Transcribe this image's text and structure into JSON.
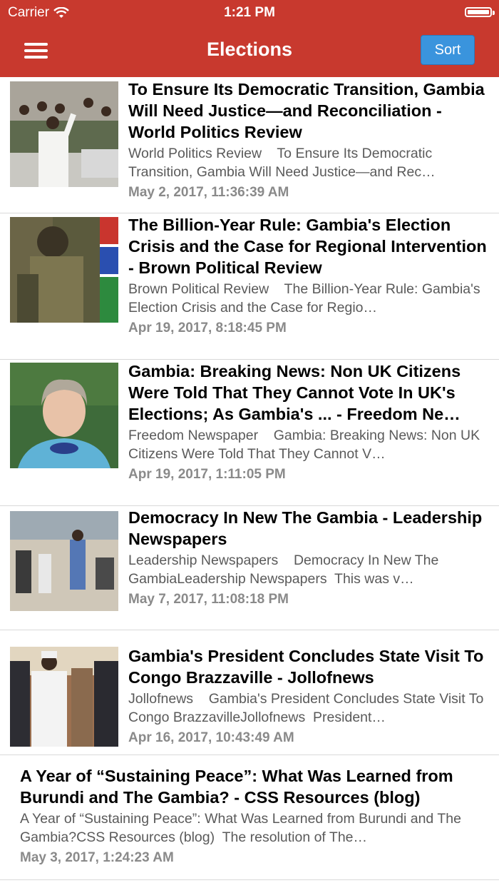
{
  "status_bar": {
    "carrier": "Carrier",
    "time": "1:21 PM"
  },
  "nav": {
    "title": "Elections",
    "sort_label": "Sort",
    "menu_icon": "hamburger-menu-icon"
  },
  "colors": {
    "header": "#c8392e",
    "sort_button": "#3a94dd",
    "meta_text": "#8a8a8a"
  },
  "articles": [
    {
      "title": "To Ensure Its Democratic Transition, Gambia Will Need Justice—and Reconciliation - World Politics Review",
      "description": "World Politics Review    To Ensure Its Democratic Transition, Gambia Will Need Justice—and Rec…",
      "date": "May 2, 2017, 11:36:39 AM",
      "has_image": true
    },
    {
      "title": "The Billion-Year Rule: Gambia's Election Crisis and the Case for Regional Intervention - Brown Political Review",
      "description": "Brown Political Review    The Billion-Year Rule: Gambia's Election Crisis and the Case for Regio…",
      "date": "Apr 19, 2017, 8:18:45 PM",
      "has_image": true
    },
    {
      "title": "Gambia: Breaking News: Non UK Citizens Were Told That They Cannot Vote In UK's Elections; As Gambia's ... - Freedom Ne…",
      "description": "Freedom Newspaper    Gambia: Breaking News: Non UK Citizens Were Told That They Cannot V…",
      "date": "Apr 19, 2017, 1:11:05 PM",
      "has_image": true
    },
    {
      "title": "Democracy In New The Gambia - Leadership Newspapers",
      "description": "Leadership Newspapers    Democracy In New The GambiaLeadership Newspapers  This was v…",
      "date": "May 7, 2017, 11:08:18 PM",
      "has_image": true
    },
    {
      "title": "Gambia's President Concludes State Visit To Congo Brazzaville - Jollofnews",
      "description": "Jollofnews    Gambia's President Concludes State Visit To Congo BrazzavilleJollofnews  President…",
      "date": "Apr 16, 2017, 10:43:49 AM",
      "has_image": true
    },
    {
      "title": "A Year of “Sustaining Peace”: What Was Learned from Burundi and The Gambia? - CSS Resources (blog)",
      "description": "A Year of “Sustaining Peace”: What Was Learned from Burundi and The Gambia?CSS Resources (blog)  The resolution of The…",
      "date": "May 3, 2017, 1:24:23 AM",
      "has_image": false
    }
  ]
}
